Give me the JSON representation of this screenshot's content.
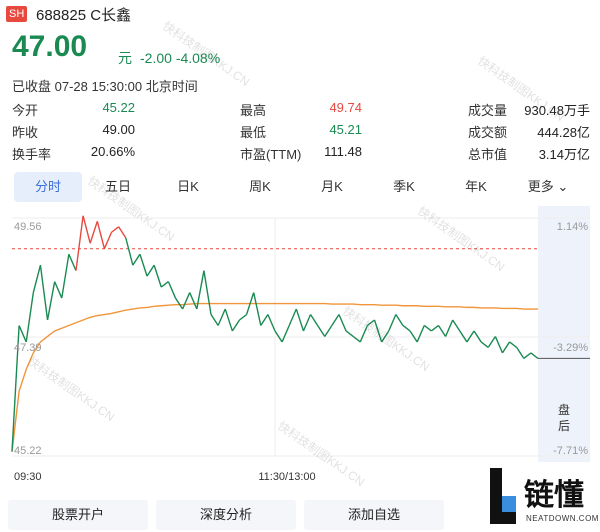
{
  "header": {
    "market_badge": "SH",
    "title": "688825 C长鑫",
    "price": "47.00",
    "unit": "元",
    "change": "-2.00",
    "change_pct": "-4.08%",
    "status": "已收盘 07-28 15:30:00 北京时间"
  },
  "quotes": [
    {
      "label": "今开",
      "value": "45.22",
      "color": "green"
    },
    {
      "label": "最高",
      "value": "49.74",
      "color": "red"
    },
    {
      "label": "成交量",
      "value": "930.48万手",
      "color": "plain"
    },
    {
      "label": "昨收",
      "value": "49.00",
      "color": "plain"
    },
    {
      "label": "最低",
      "value": "45.21",
      "color": "green"
    },
    {
      "label": "成交额",
      "value": "444.28亿",
      "color": "plain"
    },
    {
      "label": "换手率",
      "value": "20.66%",
      "color": "plain"
    },
    {
      "label": "市盈(TTM)",
      "value": "111.48",
      "color": "plain"
    },
    {
      "label": "总市值",
      "value": "3.14万亿",
      "color": "plain"
    }
  ],
  "tabs": [
    "分时",
    "五日",
    "日K",
    "周K",
    "月K",
    "季K",
    "年K",
    "更多"
  ],
  "chart_data": {
    "type": "line",
    "y_left_ticks": [
      "49.56",
      "47.39",
      "45.22"
    ],
    "y_right_ticks": [
      "1.14%",
      "-3.29%",
      "-7.71%"
    ],
    "x_ticks": [
      "09:30",
      "11:30/13:00"
    ],
    "after_hours_label": "盘后",
    "ylim": [
      45.22,
      49.56
    ],
    "prev_close": 49.0,
    "price_series": [
      45.3,
      47.6,
      47.3,
      48.2,
      48.7,
      47.7,
      48.4,
      48.1,
      48.9,
      48.6,
      49.6,
      49.1,
      49.5,
      49.0,
      49.3,
      49.4,
      49.2,
      48.7,
      48.9,
      48.5,
      48.7,
      48.3,
      48.4,
      48.1,
      47.9,
      48.2,
      47.9,
      48.6,
      47.8,
      47.6,
      47.9,
      47.5,
      47.7,
      47.8,
      48.2,
      47.6,
      47.8,
      47.5,
      47.3,
      47.6,
      47.9,
      47.5,
      47.8,
      47.6,
      47.4,
      47.6,
      47.8,
      47.5,
      47.4,
      47.3,
      47.6,
      47.7,
      47.3,
      47.5,
      47.8,
      47.6,
      47.5,
      47.3,
      47.6,
      47.5,
      47.6,
      47.4,
      47.7,
      47.5,
      47.3,
      47.5,
      47.3,
      47.2,
      47.4,
      47.1,
      47.3,
      47.2,
      47.0,
      47.1,
      47.0
    ],
    "avg_series": [
      45.3,
      46.4,
      46.8,
      47.1,
      47.3,
      47.4,
      47.5,
      47.55,
      47.6,
      47.65,
      47.7,
      47.75,
      47.78,
      47.8,
      47.82,
      47.85,
      47.88,
      47.9,
      47.92,
      47.93,
      47.95,
      47.96,
      47.97,
      47.98,
      47.98,
      47.99,
      48.0,
      48.0,
      48.0,
      48.0,
      48.0,
      48.0,
      48.0,
      48.0,
      48.0,
      48.0,
      48.0,
      48.0,
      48.0,
      48.0,
      48.0,
      48.0,
      48.0,
      48.0,
      48.0,
      47.99,
      47.99,
      47.99,
      47.99,
      47.98,
      47.98,
      47.98,
      47.97,
      47.97,
      47.97,
      47.96,
      47.96,
      47.96,
      47.95,
      47.95,
      47.95,
      47.94,
      47.94,
      47.94,
      47.93,
      47.93,
      47.92,
      47.92,
      47.92,
      47.91,
      47.91,
      47.91,
      47.9,
      47.9,
      47.9
    ],
    "after_hours_value": 47.0
  },
  "buttons": [
    "股票开户",
    "深度分析",
    "添加自选"
  ],
  "logo": {
    "name": "链懂",
    "sub": "NEATDOWN.COM"
  },
  "watermark": "快科技制图KKJ.CN",
  "colors": {
    "down": "#1a8a52",
    "up": "#e8493f",
    "avg": "#f0953a",
    "accent": "#3a6fd8"
  }
}
